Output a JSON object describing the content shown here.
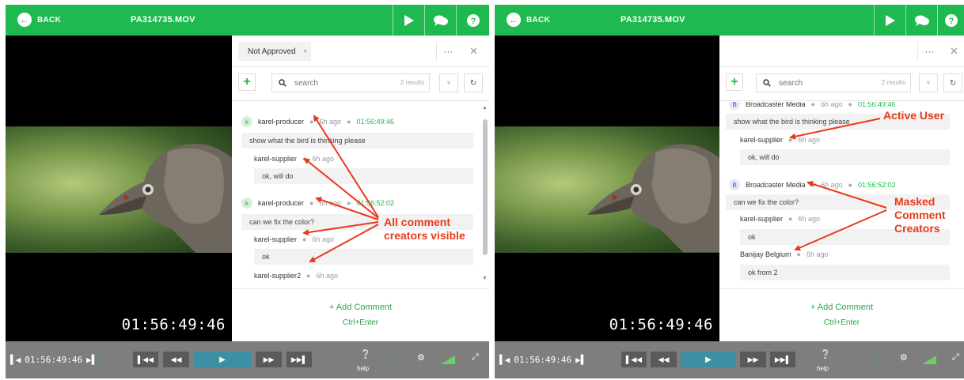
{
  "left": {
    "back_label": "BACK",
    "filename": "PA314735.MOV",
    "status": "Not Approved",
    "search_placeholder": "search",
    "results": "2 results",
    "comments": [
      {
        "avatar": "k",
        "author": "karel-producer",
        "ago": "6h ago",
        "timecode": "01:56:49:46",
        "text": "show what the bird is thinking please"
      },
      {
        "author": "karel-supplier",
        "ago": "6h ago",
        "text": "ok, will do"
      },
      {
        "avatar": "k",
        "author": "karel-producer",
        "ago": "6h ago",
        "timecode": "01:56:52:02",
        "text": "can we fix the color?"
      },
      {
        "author": "karel-supplier",
        "ago": "6h ago",
        "text": "ok"
      },
      {
        "author": "karel-supplier2",
        "ago": "6h ago"
      }
    ],
    "add_comment": "+ Add Comment",
    "shortcut": "Ctrl+Enter",
    "timecode": "01:56:49:46",
    "controls_timecode": "01:56:49:46",
    "help": "help",
    "annotation": "All comment creators visible"
  },
  "right": {
    "back_label": "BACK",
    "filename": "PA314735.MOV",
    "search_placeholder": "search",
    "results": "2 results",
    "comments": [
      {
        "avatar": "B",
        "author": "Broadcaster Media",
        "ago": "6h ago",
        "timecode": "01:56:49:46",
        "text": "show what the bird is thinking please"
      },
      {
        "author": "karel-supplier",
        "ago": "6h ago",
        "text": "ok, will do"
      },
      {
        "avatar": "B",
        "author": "Broadcaster Media",
        "ago": "6h ago",
        "timecode": "01:56:52:02",
        "text": "can we fix the color?"
      },
      {
        "author": "karel-supplier",
        "ago": "6h ago",
        "text": "ok"
      },
      {
        "author": "Banijay Belgium",
        "ago": "6h ago",
        "text": "ok from 2"
      }
    ],
    "add_comment": "+ Add Comment",
    "shortcut": "Ctrl+Enter",
    "timecode": "01:56:49:46",
    "controls_timecode": "01:56:49:46",
    "help": "help",
    "annotation_active": "Active User",
    "annotation_masked": "Masked Comment Creators"
  },
  "colors": {
    "brand": "#1fba4f",
    "annotation": "#e8391a",
    "play": "#3d8fa3"
  },
  "icons": [
    "back-arrow-icon",
    "play-icon",
    "chat-icon",
    "help-icon",
    "chevron-down-icon",
    "more-icon",
    "close-icon",
    "plus-icon",
    "search-icon",
    "filter-icon",
    "refresh-icon"
  ]
}
